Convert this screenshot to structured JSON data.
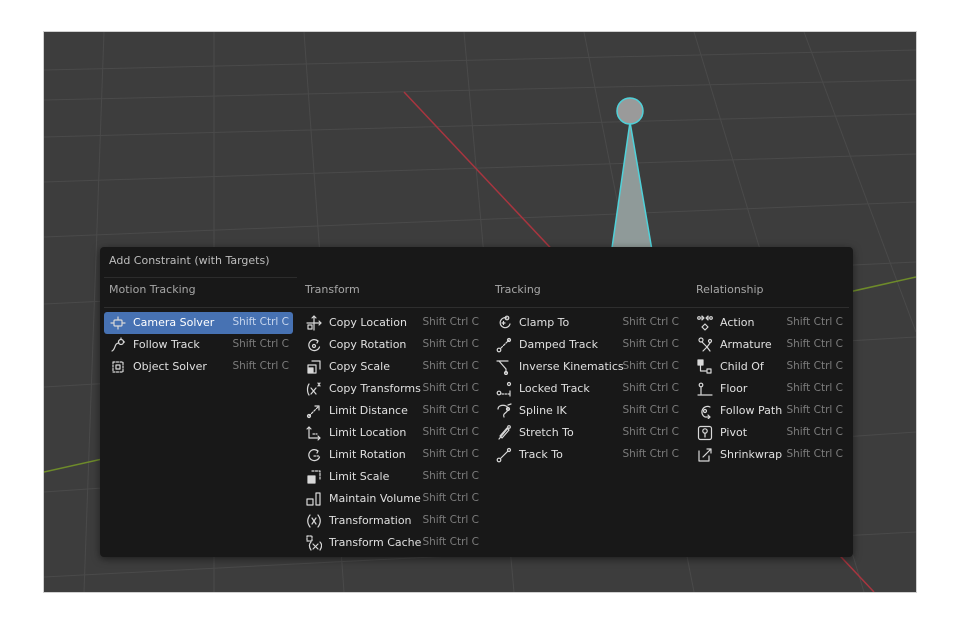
{
  "menu": {
    "title": "Add Constraint (with Targets)",
    "columns": [
      {
        "heading": "Motion Tracking",
        "items": [
          {
            "label": "Camera Solver",
            "shortcut": "Shift Ctrl C",
            "icon": "camera-solver-icon",
            "active": true
          },
          {
            "label": "Follow Track",
            "shortcut": "Shift Ctrl C",
            "icon": "follow-track-icon"
          },
          {
            "label": "Object Solver",
            "shortcut": "Shift Ctrl C",
            "icon": "object-solver-icon"
          }
        ]
      },
      {
        "heading": "Transform",
        "items": [
          {
            "label": "Copy Location",
            "shortcut": "Shift Ctrl C",
            "icon": "copy-location-icon"
          },
          {
            "label": "Copy Rotation",
            "shortcut": "Shift Ctrl C",
            "icon": "copy-rotation-icon"
          },
          {
            "label": "Copy Scale",
            "shortcut": "Shift Ctrl C",
            "icon": "copy-scale-icon"
          },
          {
            "label": "Copy Transforms",
            "shortcut": "Shift Ctrl C",
            "icon": "copy-transforms-icon"
          },
          {
            "label": "Limit Distance",
            "shortcut": "Shift Ctrl C",
            "icon": "limit-distance-icon"
          },
          {
            "label": "Limit Location",
            "shortcut": "Shift Ctrl C",
            "icon": "limit-location-icon"
          },
          {
            "label": "Limit Rotation",
            "shortcut": "Shift Ctrl C",
            "icon": "limit-rotation-icon"
          },
          {
            "label": "Limit Scale",
            "shortcut": "Shift Ctrl C",
            "icon": "limit-scale-icon"
          },
          {
            "label": "Maintain Volume",
            "shortcut": "Shift Ctrl C",
            "icon": "maintain-volume-icon"
          },
          {
            "label": "Transformation",
            "shortcut": "Shift Ctrl C",
            "icon": "transformation-icon"
          },
          {
            "label": "Transform Cache",
            "shortcut": "Shift Ctrl C",
            "icon": "transform-cache-icon"
          }
        ]
      },
      {
        "heading": "Tracking",
        "items": [
          {
            "label": "Clamp To",
            "shortcut": "Shift Ctrl C",
            "icon": "clamp-to-icon"
          },
          {
            "label": "Damped Track",
            "shortcut": "Shift Ctrl C",
            "icon": "damped-track-icon"
          },
          {
            "label": "Inverse Kinematics",
            "shortcut": "Shift Ctrl C",
            "icon": "inverse-kinematics-icon"
          },
          {
            "label": "Locked Track",
            "shortcut": "Shift Ctrl C",
            "icon": "locked-track-icon"
          },
          {
            "label": "Spline IK",
            "shortcut": "Shift Ctrl C",
            "icon": "spline-ik-icon"
          },
          {
            "label": "Stretch To",
            "shortcut": "Shift Ctrl C",
            "icon": "stretch-to-icon"
          },
          {
            "label": "Track To",
            "shortcut": "Shift Ctrl C",
            "icon": "track-to-icon"
          }
        ]
      },
      {
        "heading": "Relationship",
        "items": [
          {
            "label": "Action",
            "shortcut": "Shift Ctrl C",
            "icon": "action-icon"
          },
          {
            "label": "Armature",
            "shortcut": "Shift Ctrl C",
            "icon": "armature-icon"
          },
          {
            "label": "Child Of",
            "shortcut": "Shift Ctrl C",
            "icon": "child-of-icon"
          },
          {
            "label": "Floor",
            "shortcut": "Shift Ctrl C",
            "icon": "floor-icon"
          },
          {
            "label": "Follow Path",
            "shortcut": "Shift Ctrl C",
            "icon": "follow-path-icon"
          },
          {
            "label": "Pivot",
            "shortcut": "Shift Ctrl C",
            "icon": "pivot-icon"
          },
          {
            "label": "Shrinkwrap",
            "shortcut": "Shift Ctrl C",
            "icon": "shrinkwrap-icon"
          }
        ]
      }
    ]
  },
  "colors": {
    "highlight": "#4772b3",
    "menu_background": "#181818",
    "viewport_background": "#3d3d3d",
    "x_axis": "#a8353f",
    "y_axis": "#6e8b2a",
    "bone_outline": "#4fd1d9"
  }
}
